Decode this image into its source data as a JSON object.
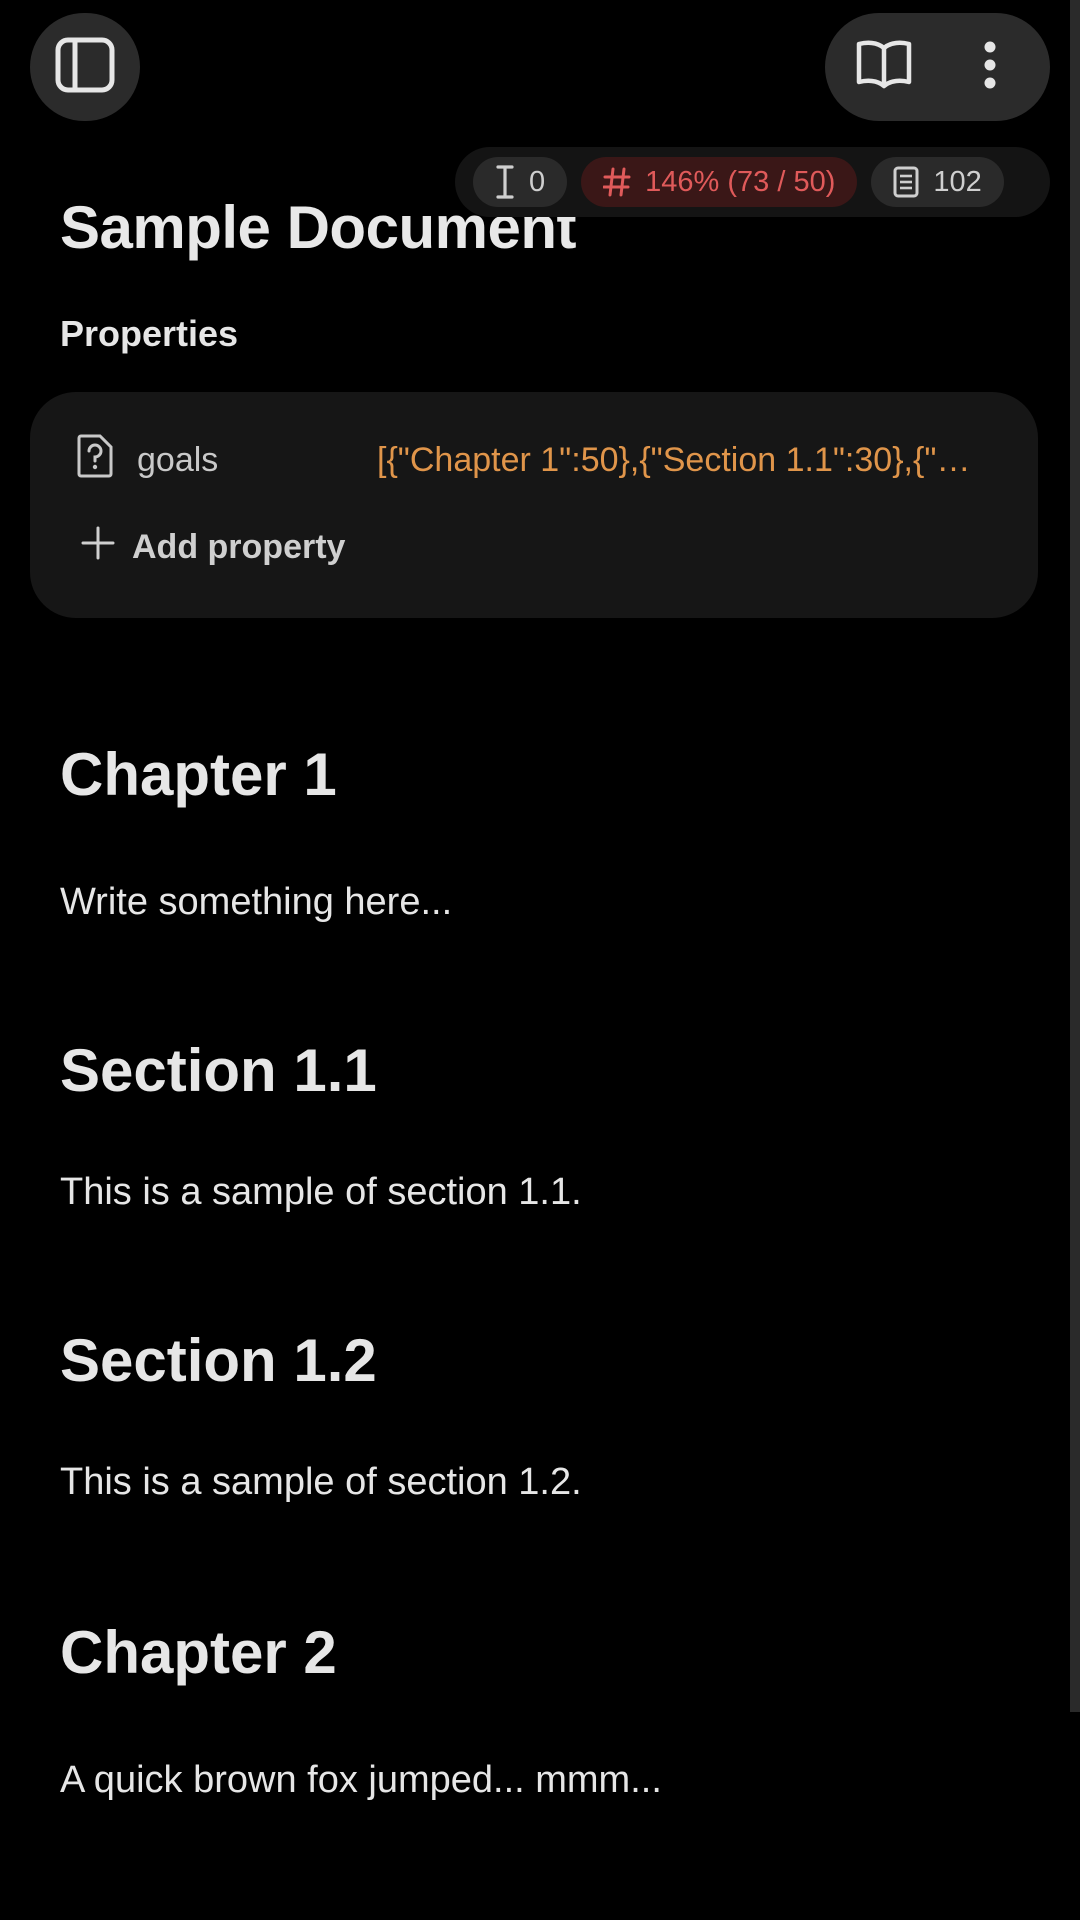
{
  "toolbar": {
    "sidebar_icon": "sidebar-toggle-icon",
    "reading_icon": "book-open-icon",
    "menu_icon": "more-vertical-icon"
  },
  "stats": {
    "cursor_count": "0",
    "goal_progress": "146% (73 / 50)",
    "word_count": "102",
    "warn_color": "#e05a5a"
  },
  "document": {
    "title": "Sample Document",
    "properties_heading": "Properties",
    "properties": [
      {
        "icon": "unknown-type-icon",
        "key": "goals",
        "value": "[{\"Chapter 1\":50},{\"Section 1.1\":30},{\"S..."
      }
    ],
    "add_property_label": "Add property",
    "value_color": "#e0954a"
  },
  "content": [
    {
      "type": "heading",
      "text": "Chapter 1"
    },
    {
      "type": "paragraph",
      "text": "Write something here..."
    },
    {
      "type": "heading",
      "text": "Section 1.1"
    },
    {
      "type": "paragraph",
      "text": "This is a sample of section 1.1."
    },
    {
      "type": "heading",
      "text": "Section 1.2"
    },
    {
      "type": "paragraph",
      "text": "This is a sample of section 1.2."
    },
    {
      "type": "heading",
      "text": "Chapter 2"
    },
    {
      "type": "paragraph",
      "text": "A quick brown fox jumped... mmm..."
    }
  ]
}
